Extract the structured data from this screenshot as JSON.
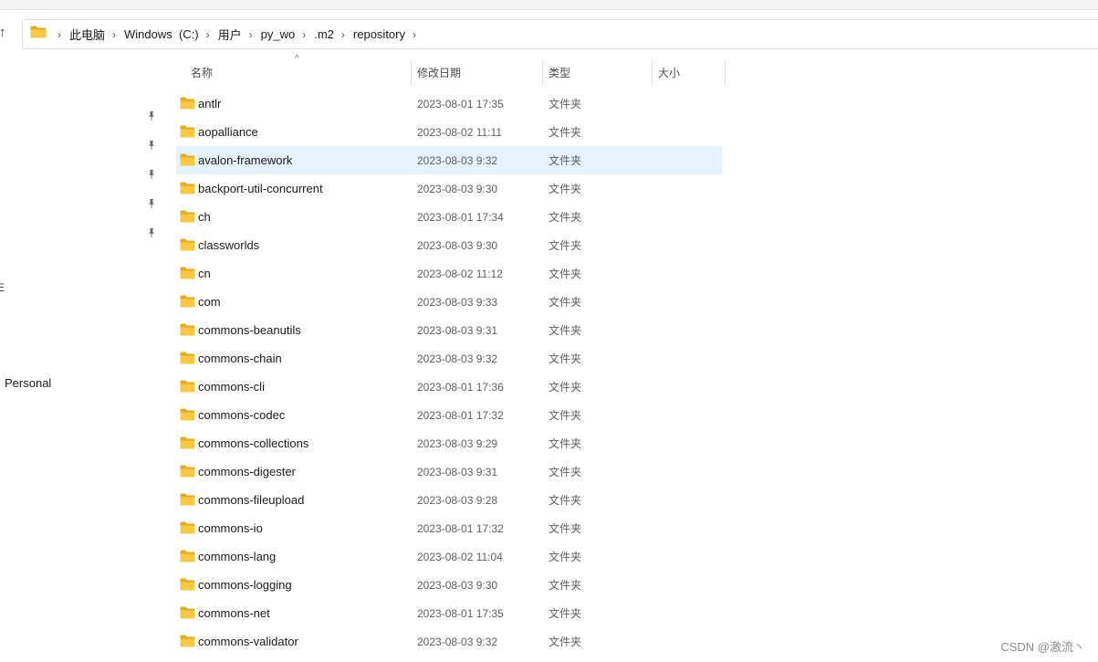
{
  "address": {
    "crumbs": [
      "此电脑",
      "Windows  (C:)",
      "用户",
      "py_wo",
      ".m2",
      "repository"
    ]
  },
  "nav": {
    "personal_label": "Personal",
    "stub_label": "E"
  },
  "columns": {
    "name": "名称",
    "date": "修改日期",
    "type": "类型",
    "size": "大小"
  },
  "rows": [
    {
      "name": "antlr",
      "date": "2023-08-01 17:35",
      "type": "文件夹"
    },
    {
      "name": "aopalliance",
      "date": "2023-08-02 11:11",
      "type": "文件夹"
    },
    {
      "name": "avalon-framework",
      "date": "2023-08-03 9:32",
      "type": "文件夹"
    },
    {
      "name": "backport-util-concurrent",
      "date": "2023-08-03 9:30",
      "type": "文件夹"
    },
    {
      "name": "ch",
      "date": "2023-08-01 17:34",
      "type": "文件夹"
    },
    {
      "name": "classworlds",
      "date": "2023-08-03 9:30",
      "type": "文件夹"
    },
    {
      "name": "cn",
      "date": "2023-08-02 11:12",
      "type": "文件夹"
    },
    {
      "name": "com",
      "date": "2023-08-03 9:33",
      "type": "文件夹"
    },
    {
      "name": "commons-beanutils",
      "date": "2023-08-03 9:31",
      "type": "文件夹"
    },
    {
      "name": "commons-chain",
      "date": "2023-08-03 9:32",
      "type": "文件夹"
    },
    {
      "name": "commons-cli",
      "date": "2023-08-01 17:36",
      "type": "文件夹"
    },
    {
      "name": "commons-codec",
      "date": "2023-08-01 17:32",
      "type": "文件夹"
    },
    {
      "name": "commons-collections",
      "date": "2023-08-03 9:29",
      "type": "文件夹"
    },
    {
      "name": "commons-digester",
      "date": "2023-08-03 9:31",
      "type": "文件夹"
    },
    {
      "name": "commons-fileupload",
      "date": "2023-08-03 9:28",
      "type": "文件夹"
    },
    {
      "name": "commons-io",
      "date": "2023-08-01 17:32",
      "type": "文件夹"
    },
    {
      "name": "commons-lang",
      "date": "2023-08-02 11:04",
      "type": "文件夹"
    },
    {
      "name": "commons-logging",
      "date": "2023-08-03 9:30",
      "type": "文件夹"
    },
    {
      "name": "commons-net",
      "date": "2023-08-01 17:35",
      "type": "文件夹"
    },
    {
      "name": "commons-validator",
      "date": "2023-08-03 9:32",
      "type": "文件夹"
    }
  ],
  "selected_row": 2,
  "watermark": "CSDN @激流丶",
  "colors": {
    "folder": "#f7c842",
    "folder_dark": "#e8a91c",
    "selection": "#e5f3ff"
  },
  "icons": {
    "folder": "folder-icon",
    "pin": "pin-icon",
    "up": "arrow-up-icon",
    "chevron": "chevron-right-icon",
    "sort": "sort-ascending-icon"
  }
}
